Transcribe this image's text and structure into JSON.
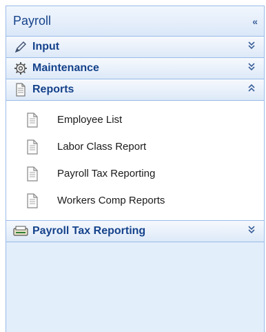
{
  "panel": {
    "title": "Payroll",
    "collapse_glyph": "«"
  },
  "sections": {
    "input": {
      "label": "Input",
      "icon": "pencil-icon",
      "chevron": "expand"
    },
    "maintenance": {
      "label": "Maintenance",
      "icon": "gear-icon",
      "chevron": "expand"
    },
    "reports": {
      "label": "Reports",
      "icon": "document-icon",
      "chevron": "collapse"
    },
    "payroll_tax": {
      "label": "Payroll Tax Reporting",
      "icon": "report-icon",
      "chevron": "expand"
    }
  },
  "reports_items": [
    {
      "label": "Employee List",
      "icon": "document-icon"
    },
    {
      "label": "Labor Class Report",
      "icon": "document-icon"
    },
    {
      "label": "Payroll Tax Reporting",
      "icon": "document-icon"
    },
    {
      "label": "Workers Comp Reports",
      "icon": "document-icon"
    }
  ],
  "colors": {
    "header_text": "#15428b",
    "border": "#99bbe8",
    "panel_bg": "#e3eefb"
  }
}
